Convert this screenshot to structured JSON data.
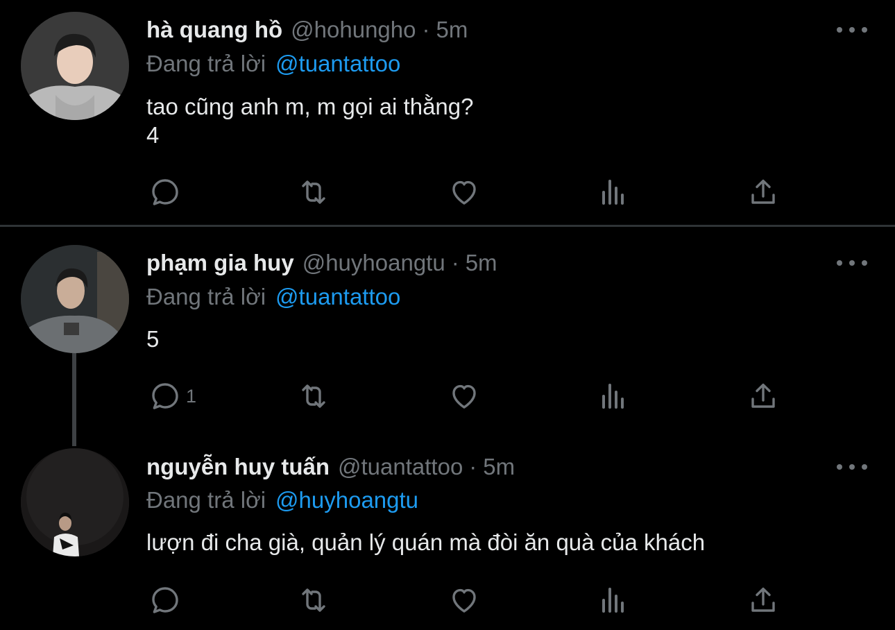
{
  "tweets": [
    {
      "name": "hà quang hồ",
      "handle": "@hohungho",
      "separator": "·",
      "time": "5m",
      "reply_prefix": "Đang trả lời",
      "reply_to": "@tuantattoo",
      "text": "tao cũng anh m, m gọi ai thằng?\n4",
      "reply_count": ""
    },
    {
      "name": "phạm gia huy",
      "handle": "@huyhoangtu",
      "separator": "·",
      "time": "5m",
      "reply_prefix": "Đang trả lời",
      "reply_to": "@tuantattoo",
      "text": "5",
      "reply_count": "1"
    },
    {
      "name": "nguyễn huy tuấn",
      "handle": "@tuantattoo",
      "separator": "·",
      "time": "5m",
      "reply_prefix": "Đang trả lời",
      "reply_to": "@huyhoangtu",
      "text": "lượn đi cha già, quản lý quán mà đòi ăn quà của khách",
      "reply_count": ""
    }
  ],
  "icons": {
    "reply": "reply-icon",
    "retweet": "retweet-icon",
    "like": "like-icon",
    "views": "views-icon",
    "share": "share-icon",
    "more": "more-icon"
  },
  "colors": {
    "background": "#000000",
    "primary_text": "#e7e9ea",
    "secondary_text": "#71767b",
    "accent": "#1d9bf0",
    "divider": "#2f3336"
  }
}
